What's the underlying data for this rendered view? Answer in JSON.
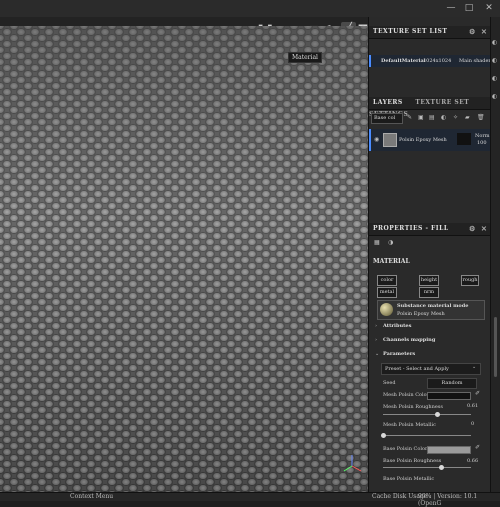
{
  "window": {
    "controls": [
      "—",
      "□",
      "✕"
    ]
  },
  "viewport": {
    "tooltip": "Material",
    "toolbar_icons": [
      "camera-switch-icon",
      "pause-icon",
      "screenshot-icon",
      "sphere-icon",
      "video-icon",
      "moon-icon",
      "settings-icon",
      "brush-icon",
      "camera-icon"
    ]
  },
  "texture_set_list": {
    "title": "TEXTURE SET LIST",
    "item_name": "DefaultMaterial",
    "item_res": "1024x1024",
    "item_shader": "Main shader"
  },
  "layers": {
    "tab_layers": "LAYERS",
    "tab_settings": "TEXTURE SET SETTINGS",
    "channel_select": "Base col",
    "layer_name": "Polsin Epoxy Mesh",
    "blend_mode": "Norm",
    "opacity": "100"
  },
  "properties": {
    "title": "PROPERTIES - FILL",
    "material_label": "MATERIAL",
    "chips": [
      "color",
      "height",
      "rough",
      "metal",
      "nrm"
    ],
    "substance_title": "Substance material mode",
    "substance_name": "Polsin Epoxy Mesh",
    "attributes": "Attributes",
    "channels_mapping": "Channels mapping",
    "parameters": "Parameters",
    "preset": "Preset - Select and Apply",
    "seed_label": "Seed",
    "seed_value": "Random",
    "params": [
      {
        "label": "Mesh Polsin Color",
        "type": "color"
      },
      {
        "label": "Mesh Polsin Roughness",
        "value": "0.61",
        "level": 0.61
      },
      {
        "label": "Mesh Polsin Metallic",
        "value": "0",
        "level": 0
      },
      {
        "label": "Base Polsin Color",
        "type": "color"
      },
      {
        "label": "Base Polsin Roughness",
        "value": "0.66",
        "level": 0.66
      },
      {
        "label": "Base Polsin Metallic",
        "type": "partial"
      }
    ]
  },
  "status": {
    "context_menu": "Context Menu",
    "cache": "Cache Disk Usage :",
    "version": "99% | Version: 10.1 (OpenG"
  }
}
